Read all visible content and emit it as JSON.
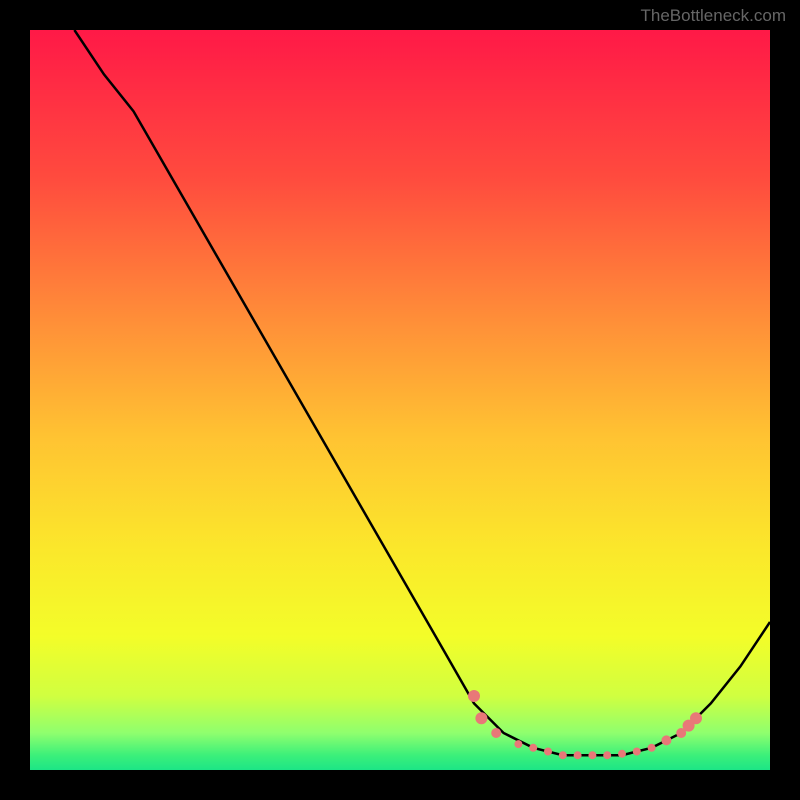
{
  "watermark": "TheBottleneck.com",
  "chart_data": {
    "type": "line",
    "title": "",
    "xlabel": "",
    "ylabel": "",
    "xlim": [
      0,
      100
    ],
    "ylim": [
      0,
      100
    ],
    "curve": [
      {
        "x": 6,
        "y": 100
      },
      {
        "x": 10,
        "y": 94
      },
      {
        "x": 14,
        "y": 89
      },
      {
        "x": 56,
        "y": 16
      },
      {
        "x": 60,
        "y": 9
      },
      {
        "x": 64,
        "y": 5
      },
      {
        "x": 68,
        "y": 3
      },
      {
        "x": 72,
        "y": 2
      },
      {
        "x": 76,
        "y": 2
      },
      {
        "x": 80,
        "y": 2
      },
      {
        "x": 84,
        "y": 3
      },
      {
        "x": 88,
        "y": 5
      },
      {
        "x": 92,
        "y": 9
      },
      {
        "x": 96,
        "y": 14
      },
      {
        "x": 100,
        "y": 20
      }
    ],
    "markers": [
      {
        "x": 60,
        "y": 10,
        "size": 6
      },
      {
        "x": 61,
        "y": 7,
        "size": 6
      },
      {
        "x": 63,
        "y": 5,
        "size": 5
      },
      {
        "x": 66,
        "y": 3.5,
        "size": 4
      },
      {
        "x": 68,
        "y": 3,
        "size": 4
      },
      {
        "x": 70,
        "y": 2.5,
        "size": 4
      },
      {
        "x": 72,
        "y": 2,
        "size": 4
      },
      {
        "x": 74,
        "y": 2,
        "size": 4
      },
      {
        "x": 76,
        "y": 2,
        "size": 4
      },
      {
        "x": 78,
        "y": 2,
        "size": 4
      },
      {
        "x": 80,
        "y": 2.2,
        "size": 4
      },
      {
        "x": 82,
        "y": 2.5,
        "size": 4
      },
      {
        "x": 84,
        "y": 3,
        "size": 4
      },
      {
        "x": 86,
        "y": 4,
        "size": 5
      },
      {
        "x": 88,
        "y": 5,
        "size": 5
      },
      {
        "x": 89,
        "y": 6,
        "size": 6
      },
      {
        "x": 90,
        "y": 7,
        "size": 6
      }
    ],
    "gradient_stops": [
      {
        "offset": 0,
        "color": "#ff1947"
      },
      {
        "offset": 20,
        "color": "#ff4b3e"
      },
      {
        "offset": 40,
        "color": "#ff9138"
      },
      {
        "offset": 55,
        "color": "#ffc332"
      },
      {
        "offset": 70,
        "color": "#fbe72b"
      },
      {
        "offset": 82,
        "color": "#f3fd29"
      },
      {
        "offset": 90,
        "color": "#d0ff40"
      },
      {
        "offset": 95,
        "color": "#8fff6e"
      },
      {
        "offset": 98,
        "color": "#3cf07a"
      },
      {
        "offset": 100,
        "color": "#1ce586"
      }
    ],
    "marker_color": "#e87878"
  }
}
